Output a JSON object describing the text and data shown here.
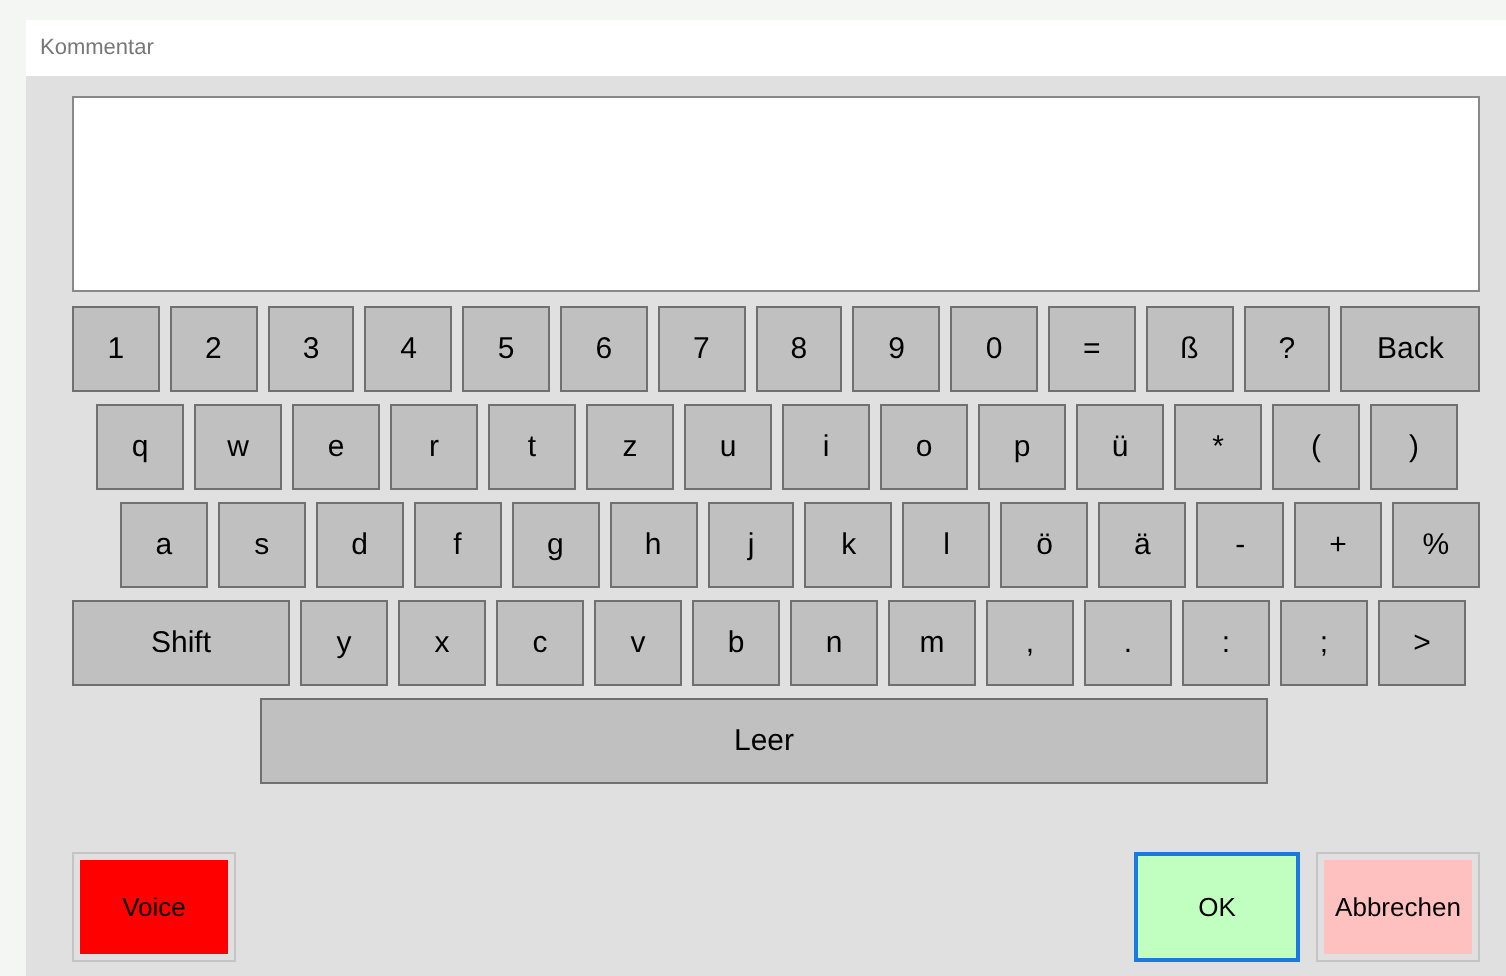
{
  "window": {
    "title": "Kommentar"
  },
  "keyboard": {
    "rows": [
      {
        "keys": [
          {
            "label": "1",
            "kind": "normal"
          },
          {
            "label": "2",
            "kind": "normal"
          },
          {
            "label": "3",
            "kind": "normal"
          },
          {
            "label": "4",
            "kind": "normal"
          },
          {
            "label": "5",
            "kind": "normal"
          },
          {
            "label": "6",
            "kind": "normal"
          },
          {
            "label": "7",
            "kind": "normal"
          },
          {
            "label": "8",
            "kind": "normal"
          },
          {
            "label": "9",
            "kind": "normal"
          },
          {
            "label": "0",
            "kind": "normal"
          },
          {
            "label": "=",
            "kind": "normal"
          },
          {
            "label": "ß",
            "kind": "normal"
          },
          {
            "label": "?",
            "kind": "normal"
          },
          {
            "label": "Back",
            "kind": "wide"
          }
        ]
      },
      {
        "keys": [
          {
            "label": "q",
            "kind": "normal"
          },
          {
            "label": "w",
            "kind": "normal"
          },
          {
            "label": "e",
            "kind": "normal"
          },
          {
            "label": "r",
            "kind": "normal"
          },
          {
            "label": "t",
            "kind": "normal"
          },
          {
            "label": "z",
            "kind": "normal"
          },
          {
            "label": "u",
            "kind": "normal"
          },
          {
            "label": "i",
            "kind": "normal"
          },
          {
            "label": "o",
            "kind": "normal"
          },
          {
            "label": "p",
            "kind": "normal"
          },
          {
            "label": "ü",
            "kind": "normal"
          },
          {
            "label": "*",
            "kind": "normal"
          },
          {
            "label": "(",
            "kind": "normal"
          },
          {
            "label": ")",
            "kind": "normal"
          }
        ]
      },
      {
        "keys": [
          {
            "label": "a",
            "kind": "normal"
          },
          {
            "label": "s",
            "kind": "normal"
          },
          {
            "label": "d",
            "kind": "normal"
          },
          {
            "label": "f",
            "kind": "normal"
          },
          {
            "label": "g",
            "kind": "normal"
          },
          {
            "label": "h",
            "kind": "normal"
          },
          {
            "label": "j",
            "kind": "normal"
          },
          {
            "label": "k",
            "kind": "normal"
          },
          {
            "label": "l",
            "kind": "normal"
          },
          {
            "label": "ö",
            "kind": "normal"
          },
          {
            "label": "ä",
            "kind": "normal"
          },
          {
            "label": "-",
            "kind": "normal"
          },
          {
            "label": "+",
            "kind": "normal"
          },
          {
            "label": "%",
            "kind": "normal"
          }
        ]
      },
      {
        "keys": [
          {
            "label": "Shift",
            "kind": "shift"
          },
          {
            "label": "y",
            "kind": "normal"
          },
          {
            "label": "x",
            "kind": "normal"
          },
          {
            "label": "c",
            "kind": "normal"
          },
          {
            "label": "v",
            "kind": "normal"
          },
          {
            "label": "b",
            "kind": "normal"
          },
          {
            "label": "n",
            "kind": "normal"
          },
          {
            "label": "m",
            "kind": "normal"
          },
          {
            "label": ",",
            "kind": "normal"
          },
          {
            "label": ".",
            "kind": "normal"
          },
          {
            "label": ":",
            "kind": "normal"
          },
          {
            "label": ";",
            "kind": "normal"
          },
          {
            "label": ">",
            "kind": "normal"
          }
        ]
      },
      {
        "keys": [
          {
            "label": "Leer",
            "kind": "space"
          }
        ]
      }
    ]
  },
  "buttons": [
    {
      "label": "Voice",
      "color": "#ff0000",
      "focused": false
    },
    {
      "label": "OK",
      "color": "#c0ffc0",
      "focused": true
    },
    {
      "label": "Abbrechen",
      "color": "#ffc0c0",
      "focused": false
    }
  ]
}
